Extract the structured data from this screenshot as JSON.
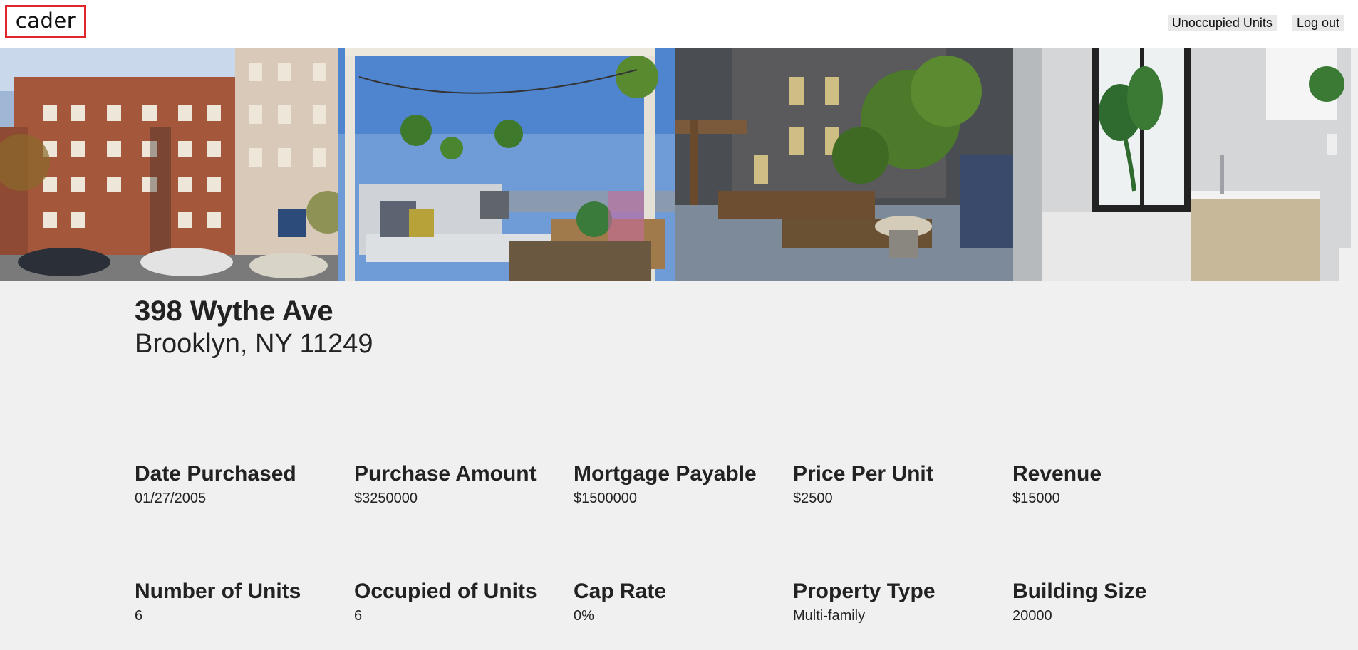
{
  "app": {
    "logo_text": "cader"
  },
  "nav": {
    "unoccupied_label": "Unoccupied Units",
    "logout_label": "Log out"
  },
  "property": {
    "street": "398 Wythe Ave",
    "city_line": "Brooklyn, NY 11249"
  },
  "stats_row1": [
    {
      "label": "Date Purchased",
      "value": "01/27/2005"
    },
    {
      "label": "Purchase Amount",
      "value": "$3250000"
    },
    {
      "label": "Mortgage Payable",
      "value": "$1500000"
    },
    {
      "label": "Price Per Unit",
      "value": "$2500"
    },
    {
      "label": "Revenue",
      "value": "$15000"
    }
  ],
  "stats_row2": [
    {
      "label": "Number of Units",
      "value": "6"
    },
    {
      "label": "Occupied of Units",
      "value": "6"
    },
    {
      "label": "Cap Rate",
      "value": "0%"
    },
    {
      "label": "Property Type",
      "value": "Multi-family"
    },
    {
      "label": "Building Size",
      "value": "20000"
    }
  ],
  "colors": {
    "logo_border": "#e0252b",
    "page_bg": "#f0f0f0",
    "nav_btn_bg": "#e9e9e9"
  }
}
